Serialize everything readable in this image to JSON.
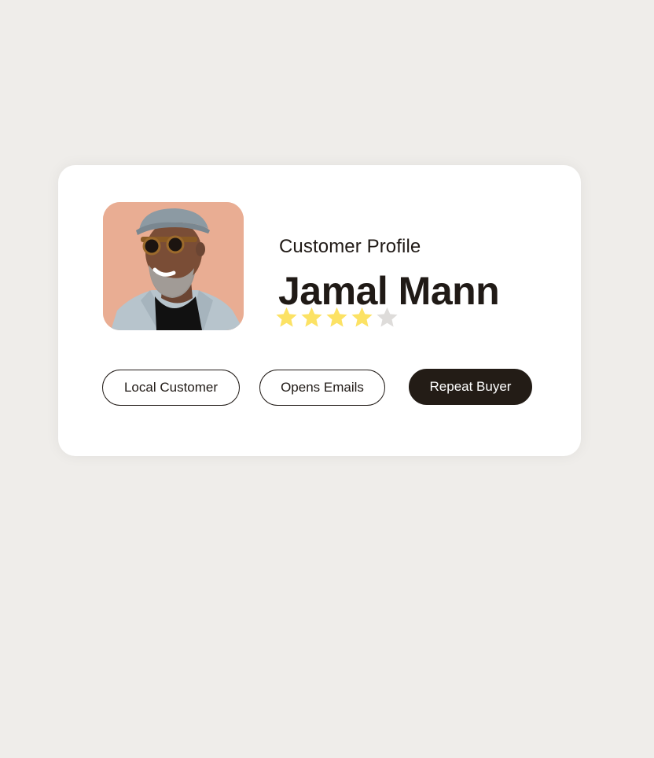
{
  "profile": {
    "section_label": "Customer Profile",
    "name": "Jamal Mann",
    "rating": {
      "value": 4,
      "max": 5,
      "filled_color": "#fce264",
      "empty_color": "#dedcda"
    },
    "avatar_icon": "customer-photo"
  },
  "tags": [
    {
      "label": "Local Customer",
      "style": "outline"
    },
    {
      "label": "Opens Emails",
      "style": "outline"
    },
    {
      "label": "Repeat Buyer",
      "style": "filled"
    }
  ],
  "colors": {
    "page_background": "#efedea",
    "card_background": "#ffffff",
    "text": "#201a16",
    "filled_tag": "#231c16"
  }
}
